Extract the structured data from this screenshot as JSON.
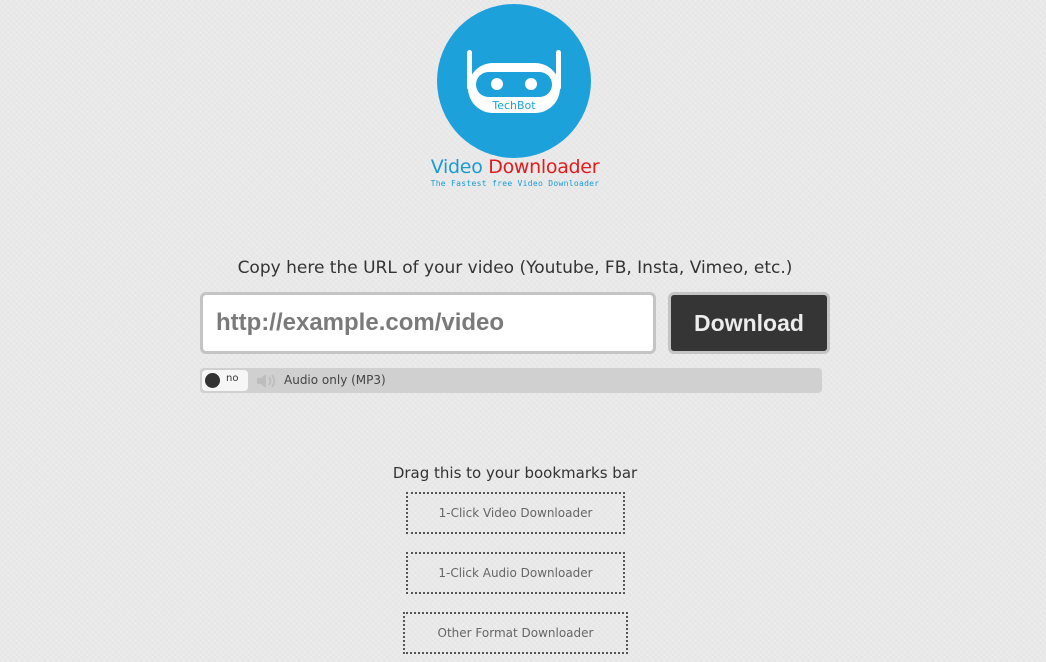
{
  "logo": {
    "bot_text": "TechBot",
    "brand_part1": "Video ",
    "brand_part2": "Downloader",
    "tagline": "The Fastest free Video Downloader"
  },
  "form": {
    "prompt": "Copy here the URL of your video (Youtube, FB, Insta, Vimeo, etc.)",
    "url_placeholder": "http://example.com/video",
    "url_value": "",
    "download_label": "Download"
  },
  "audio": {
    "toggle_label": "no",
    "toggle_on": false,
    "label": "Audio only (MP3)",
    "icon": "speaker-icon"
  },
  "bookmarks": {
    "title": "Drag this to your bookmarks bar",
    "links": [
      {
        "label": "1-Click Video Downloader"
      },
      {
        "label": "1-Click Audio Downloader"
      },
      {
        "label": "Other Format Downloader"
      }
    ]
  },
  "colors": {
    "brand_blue": "#1da1db",
    "brand_red": "#e21b1b",
    "button_bg": "#353535",
    "background": "#ececec"
  }
}
